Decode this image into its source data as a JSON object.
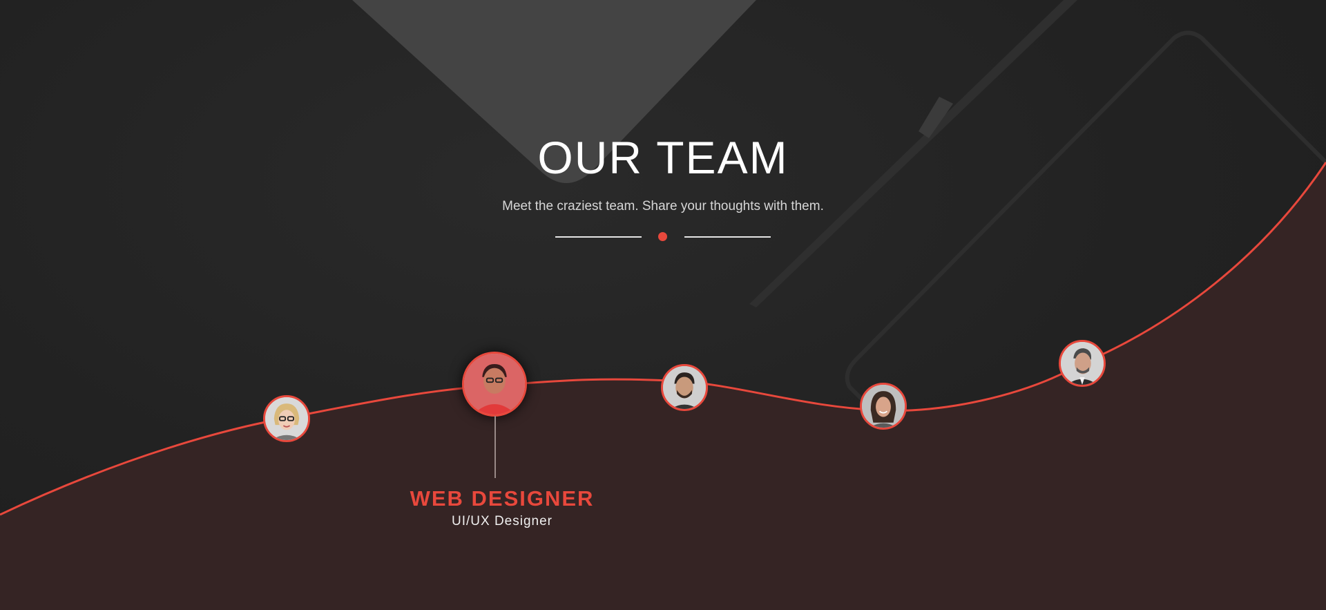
{
  "header": {
    "title": "OUR TEAM",
    "subtitle": "Meet the craziest team. Share your thoughts with them."
  },
  "colors": {
    "accent": "#e8483c",
    "background": "#232323",
    "lower_fill": "#352424"
  },
  "team": {
    "members": [
      {
        "avatar": "woman-glasses-avatar",
        "active": false
      },
      {
        "avatar": "man-red-shirt-avatar",
        "active": true
      },
      {
        "avatar": "man-beard-avatar",
        "active": false
      },
      {
        "avatar": "woman-smiling-avatar",
        "active": false
      },
      {
        "avatar": "man-suit-avatar",
        "active": false
      }
    ],
    "selected": {
      "role": "WEB DESIGNER",
      "position": "UI/UX Designer"
    }
  }
}
